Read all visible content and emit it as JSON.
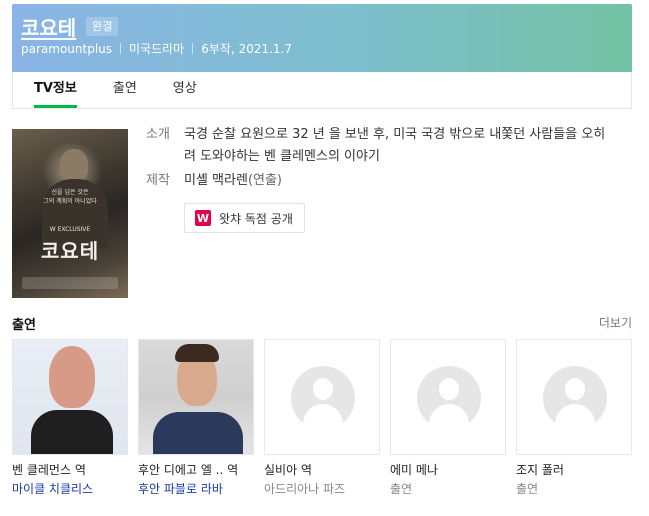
{
  "header": {
    "title": "코요테",
    "status_badge": "완결",
    "meta": [
      "paramountplus",
      "미국드라마",
      "6부작, 2021.1.7"
    ],
    "colors": {
      "gradient_start": "#8ab4e6",
      "gradient_end": "#74c2a4"
    }
  },
  "tabs": [
    {
      "label": "TV정보",
      "active": true
    },
    {
      "label": "출연",
      "active": false
    },
    {
      "label": "영상",
      "active": false
    }
  ],
  "poster": {
    "tagline_1": "선을 넘은 것은",
    "tagline_2": "그의 계획이 아니었다",
    "exclusive": "W EXCLUSIVE",
    "title": "코요테"
  },
  "info": {
    "synopsis_label": "소개",
    "synopsis": "국경 순찰 요원으로 32 년 을 보낸 후, 미국 국경 밖으로 내쫓던 사람들을 오히려 도와야하는 벤 클레멘스의 이야기",
    "production_label": "제작",
    "director": "미셸 맥라렌",
    "director_role": "(연출)",
    "watcha_button": "왓챠 독점 공개",
    "watcha_icon": "W"
  },
  "cast": {
    "title": "출연",
    "more": "더보기",
    "items": [
      {
        "role": "벤 클레먼스 역",
        "actor": "마이클 치클리스",
        "actor_link": true,
        "photo": "actor-photo"
      },
      {
        "role": "후안 디에고 엘 .. 역",
        "actor": "후안 파블로 라바",
        "actor_link": true,
        "photo": "actor-photo"
      },
      {
        "role": "실비아 역",
        "actor": "아드리아나 파즈",
        "actor_link": false,
        "photo": "placeholder"
      },
      {
        "role": "에미 메나",
        "actor": "출연",
        "actor_link": false,
        "photo": "placeholder"
      },
      {
        "role": "조지 폴러",
        "actor": "출연",
        "actor_link": false,
        "photo": "placeholder"
      }
    ]
  }
}
